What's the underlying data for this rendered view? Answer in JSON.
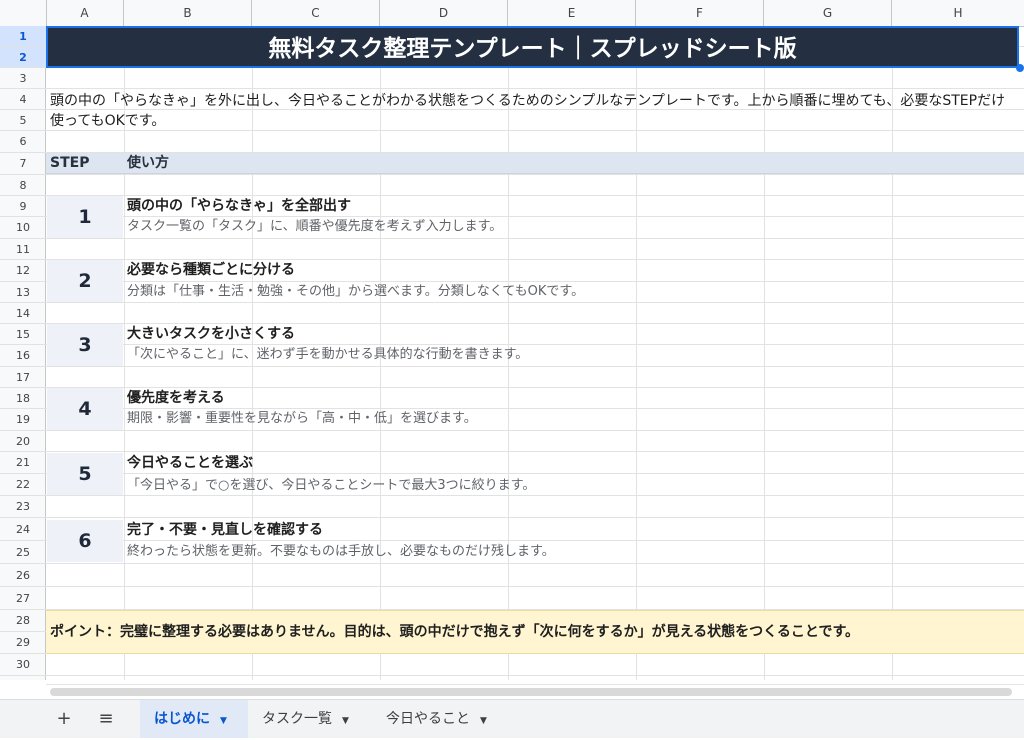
{
  "columns": [
    "A",
    "B",
    "C",
    "D",
    "E",
    "F",
    "G",
    "H"
  ],
  "rows": [
    "1",
    "2",
    "3",
    "4",
    "5",
    "6",
    "7",
    "8",
    "9",
    "10",
    "11",
    "12",
    "13",
    "14",
    "15",
    "16",
    "17",
    "18",
    "19",
    "20",
    "21",
    "22",
    "23",
    "24",
    "25",
    "26",
    "27",
    "28",
    "29",
    "30"
  ],
  "title": "無料タスク整理テンプレート｜スプレッドシート版",
  "intro": "頭の中の「やらなきゃ」を外に出し、今日やることがわかる状態をつくるためのシンプルなテンプレートです。上から順番に埋めても、必要なSTEPだけ使ってもOKです。",
  "table_header": {
    "step": "STEP",
    "usage": "使い方"
  },
  "steps": [
    {
      "num": "1",
      "title": "頭の中の「やらなきゃ」を全部出す",
      "desc": "タスク一覧の「タスク」に、順番や優先度を考えず入力します。"
    },
    {
      "num": "2",
      "title": "必要なら種類ごとに分ける",
      "desc": "分類は「仕事・生活・勉強・その他」から選べます。分類しなくてもOKです。"
    },
    {
      "num": "3",
      "title": "大きいタスクを小さくする",
      "desc": "「次にやること」に、迷わず手を動かせる具体的な行動を書きます。"
    },
    {
      "num": "4",
      "title": "優先度を考える",
      "desc": "期限・影響・重要性を見ながら「高・中・低」を選びます。"
    },
    {
      "num": "5",
      "title": "今日やることを選ぶ",
      "desc": "「今日やる」で○を選び、今日やることシートで最大3つに絞ります。"
    },
    {
      "num": "6",
      "title": "完了・不要・見直しを確認する",
      "desc": "終わったら状態を更新。不要なものは手放し、必要なものだけ残します。"
    }
  ],
  "point": "ポイント：完璧に整理する必要はありません。目的は、頭の中だけで抱えず「次に何をするか」が見える状態をつくることです。",
  "tabbar": {
    "add": "+",
    "menu": "≡",
    "tabs": [
      {
        "label": "はじめに",
        "active": true
      },
      {
        "label": "タスク一覧",
        "active": false
      },
      {
        "label": "今日やること",
        "active": false
      }
    ]
  },
  "colors": {
    "title_bg": "#243042",
    "point_bg": "#fff5d1",
    "active_tab": "#0b57d0"
  }
}
